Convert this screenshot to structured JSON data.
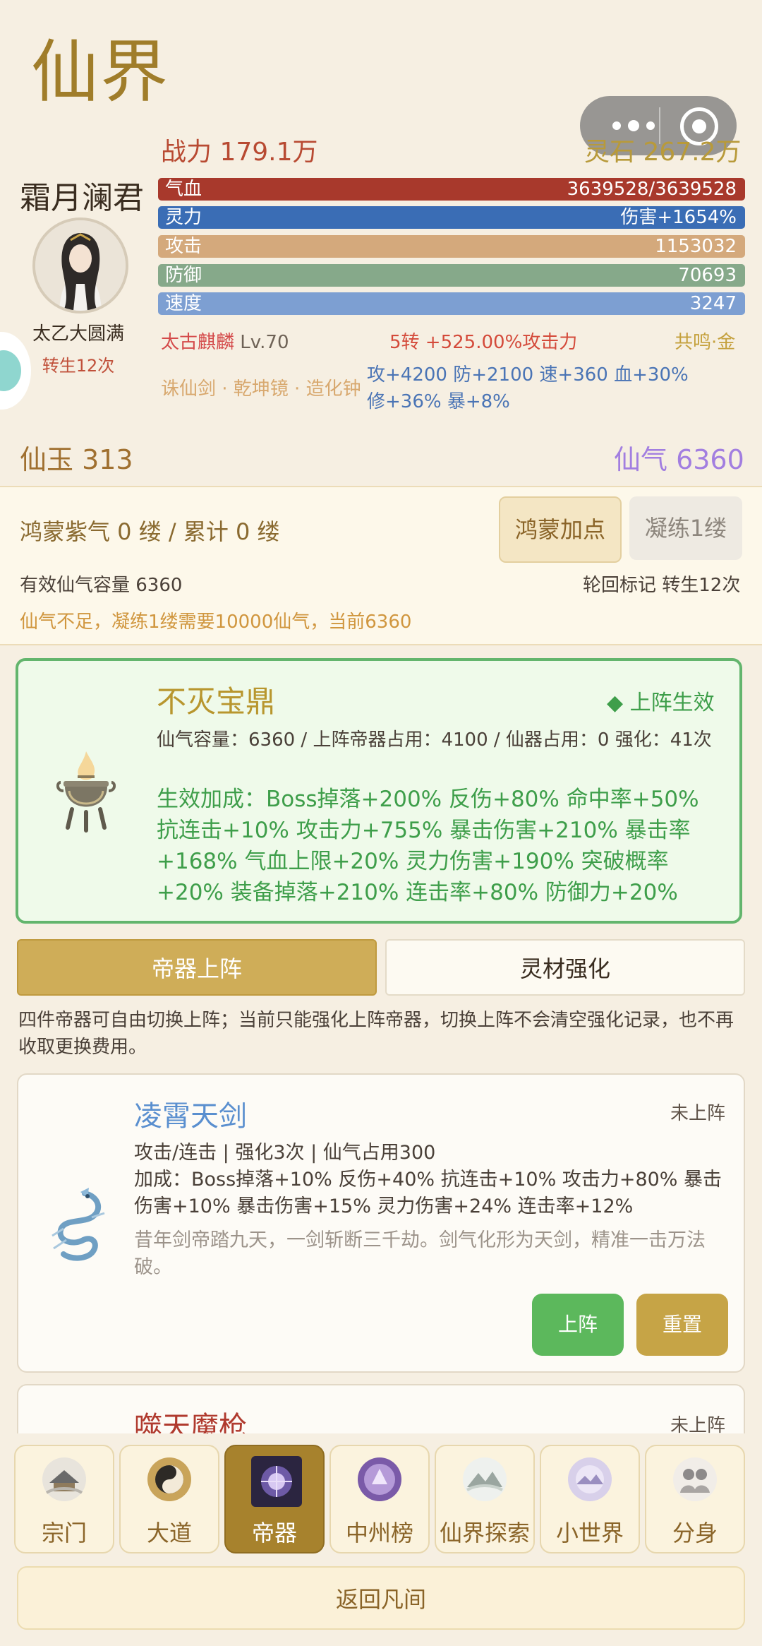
{
  "header": {
    "title": "仙界",
    "power": "战力 179.1万",
    "lingshi": "灵石 267.2万"
  },
  "character": {
    "name": "霜月澜君",
    "realm": "太乙大圆满",
    "rebirth": "转生12次"
  },
  "stats": [
    {
      "label": "气血",
      "value": "3639528/3639528",
      "color": "#a8392c"
    },
    {
      "label": "灵力",
      "value": "伤害+1654%",
      "color": "#3a6db5"
    },
    {
      "label": "攻击",
      "value": "1153032",
      "color": "#d4a97c"
    },
    {
      "label": "防御",
      "value": "70693",
      "color": "#86a98a"
    },
    {
      "label": "速度",
      "value": "3247",
      "color": "#7d9fd2"
    }
  ],
  "pet": {
    "name": "太古麒麟",
    "level": "Lv.70",
    "zhuan": "5转 +525.00%攻击力",
    "resonance": "共鸣·金"
  },
  "treasures": {
    "names": "诛仙剑 · 乾坤镜 · 造化钟",
    "bonus_line1": "攻+4200 防+2100 速+360 血+30%",
    "bonus_line2": "修+36% 暴+8%"
  },
  "currency": {
    "xianyu": "仙玉 313",
    "xianqi": "仙气 6360"
  },
  "honmeng": {
    "text": "鸿蒙紫气 0 缕 / 累计 0 缕",
    "btn_add": "鸿蒙加点",
    "btn_refine": "凝练1缕",
    "capacity": "有效仙气容量 6360",
    "mark": "轮回标记 转生12次",
    "warning": "仙气不足，凝练1缕需要10000仙气，当前6360"
  },
  "main_artifact": {
    "name": "不灭宝鼎",
    "status": "◆ 上阵生效",
    "info": "仙气容量：6360 / 上阵帝器占用：4100 / 仙器占用：0  强化：41次",
    "bonus": "生效加成：Boss掉落+200%  反伤+80%  命中率+50%  抗连击+10%  攻击力+755%  暴击伤害+210%  暴击率+168%  气血上限+20%  灵力伤害+190%  突破概率+20%  装备掉落+210%  连击率+80%  防御力+20%"
  },
  "tabs": {
    "deploy": "帝器上阵",
    "enhance": "灵材强化"
  },
  "note": "四件帝器可自由切换上阵；当前只能强化上阵帝器，切换上阵不会清空强化记录，也不再收取更换费用。",
  "items": [
    {
      "name": "凌霄天剑",
      "state": "未上阵",
      "meta": "攻击/连击 | 强化3次 | 仙气占用300",
      "bonus": "加成：Boss掉落+10%  反伤+40%  抗连击+10%  攻击力+80%  暴击伤害+10%  暴击伤害+15%  灵力伤害+24%  连击率+12%",
      "desc": "昔年剑帝踏九天，一剑斩断三千劫。剑气化形为天剑，精准一击万法破。",
      "btn_on": "上阵",
      "btn_reset": "重置"
    },
    {
      "name": "噬天魔枪",
      "state": "未上阵"
    }
  ],
  "nav": [
    {
      "label": "宗门",
      "icon": "sect-icon"
    },
    {
      "label": "大道",
      "icon": "taiji-icon"
    },
    {
      "label": "帝器",
      "icon": "artifact-icon"
    },
    {
      "label": "中州榜",
      "icon": "ranking-icon"
    },
    {
      "label": "仙界探索",
      "icon": "explore-icon"
    },
    {
      "label": "小世界",
      "icon": "small-world-icon"
    },
    {
      "label": "分身",
      "icon": "clone-icon"
    }
  ],
  "back_label": "返回凡间"
}
